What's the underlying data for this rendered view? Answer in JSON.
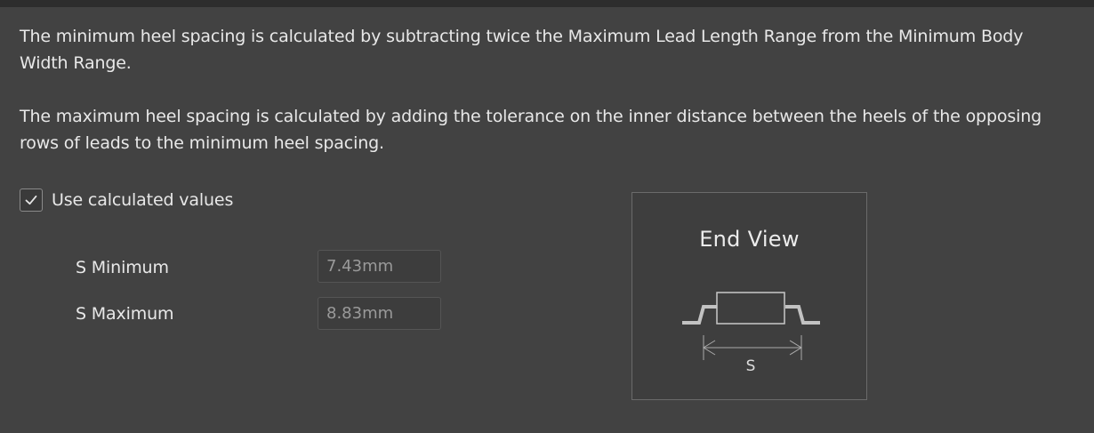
{
  "description": {
    "min_text": "The minimum heel spacing is calculated by subtracting twice the Maximum Lead Length Range from the Minimum Body Width Range.",
    "max_text": "The maximum heel spacing is calculated by adding the tolerance on the inner distance between the heels of the opposing rows of leads to the minimum heel spacing."
  },
  "use_calculated": {
    "label": "Use calculated values",
    "checked": true
  },
  "fields": {
    "s_min": {
      "label": "S Minimum",
      "value": "7.43mm"
    },
    "s_max": {
      "label": "S Maximum",
      "value": "8.83mm"
    }
  },
  "diagram": {
    "title": "End View",
    "dimension_label": "S"
  },
  "colors": {
    "background": "#424242",
    "text": "#e8e8e8",
    "disabled_text": "#9a9a9a"
  }
}
